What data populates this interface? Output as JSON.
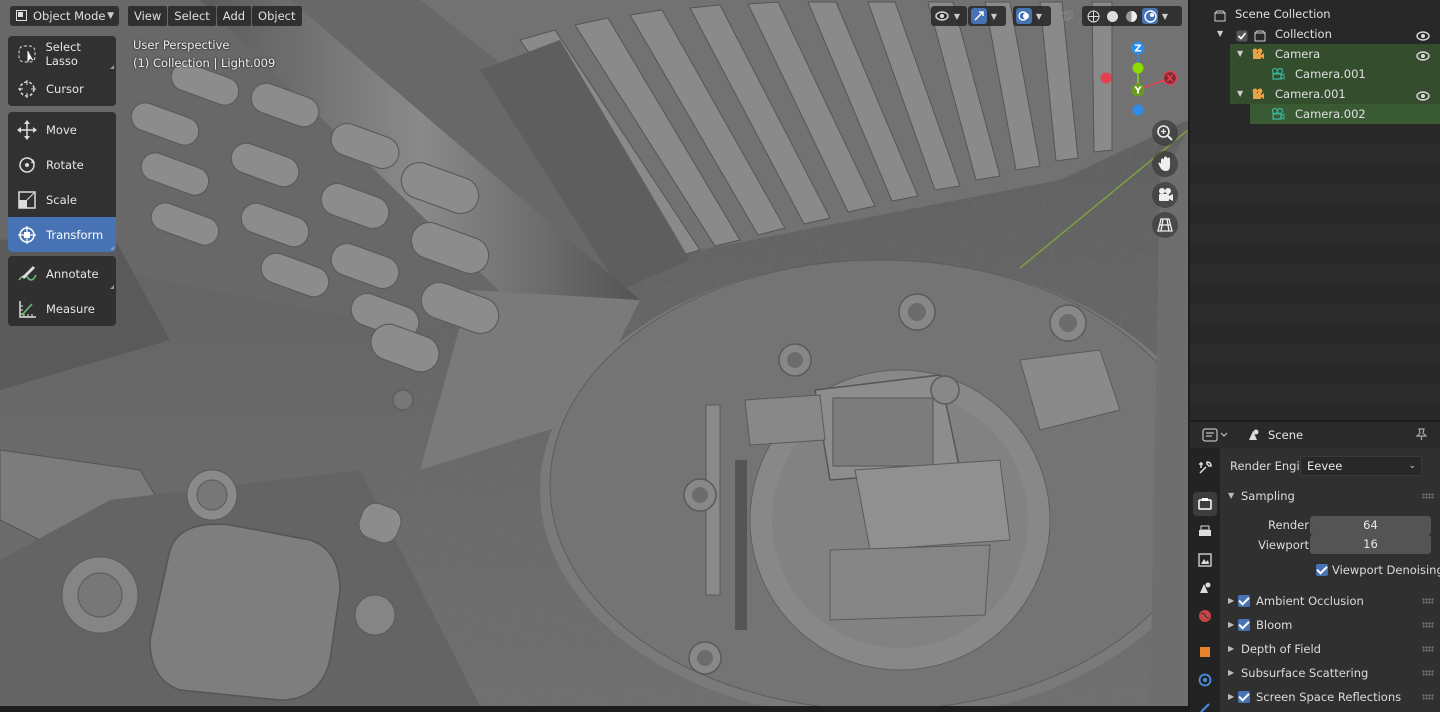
{
  "viewport": {
    "mode_selector": "Object Mode",
    "menus": [
      "View",
      "Select",
      "Add",
      "Object"
    ],
    "perspective_label": "User Perspective",
    "collection_label": "(1) Collection | Light.009",
    "gizmo_axes": {
      "z": "Z",
      "y": "Y",
      "x": "X"
    },
    "colors": {
      "x_axis": "#e53f50",
      "y_axis": "#8bdc00",
      "z_axis": "#2d8ceb",
      "active": "#4772b3"
    }
  },
  "toolbar": {
    "groups": [
      [
        {
          "label": "Select Lasso",
          "icon": "lasso-select-icon"
        },
        {
          "label": "Cursor",
          "icon": "cursor-icon"
        }
      ],
      [
        {
          "label": "Move",
          "icon": "move-icon"
        },
        {
          "label": "Rotate",
          "icon": "rotate-icon"
        },
        {
          "label": "Scale",
          "icon": "scale-icon"
        },
        {
          "label": "Transform",
          "icon": "transform-icon",
          "active": true
        }
      ],
      [
        {
          "label": "Annotate",
          "icon": "annotate-icon"
        },
        {
          "label": "Measure",
          "icon": "measure-icon"
        }
      ]
    ]
  },
  "outliner": {
    "items": [
      {
        "label": "Scene Collection",
        "icon": "scene-collection-icon"
      },
      {
        "label": "Collection",
        "icon": "collection-icon"
      },
      {
        "label": "Camera",
        "icon": "camera-object-icon"
      },
      {
        "label": "Camera.001",
        "icon": "camera-data-icon"
      },
      {
        "label": "Camera.001",
        "icon": "camera-object-icon"
      },
      {
        "label": "Camera.002",
        "icon": "camera-data-icon"
      }
    ]
  },
  "properties": {
    "context": "Scene",
    "render_engine_label": "Render Engine",
    "render_engine_value": "Eevee",
    "sampling": {
      "title": "Sampling",
      "render_label": "Render",
      "render_value": "64",
      "viewport_label": "Viewport",
      "viewport_value": "16",
      "denoise_label": "Viewport Denoising"
    },
    "panels": [
      "Ambient Occlusion",
      "Bloom",
      "Depth of Field",
      "Subsurface Scattering",
      "Screen Space Reflections"
    ]
  }
}
